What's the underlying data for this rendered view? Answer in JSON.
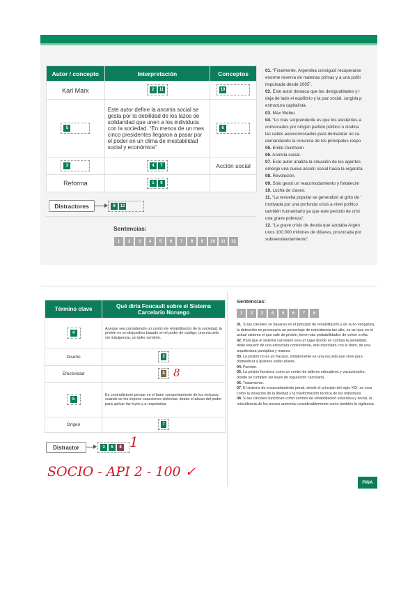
{
  "activity1": {
    "table": {
      "headers": [
        "Autor / concepto",
        "Interpretación",
        "Conceptos"
      ],
      "rows": [
        {
          "autor": "Karl Marx",
          "interp_chips": [
            "2",
            "11"
          ],
          "concept_chips": [
            "10"
          ]
        },
        {
          "autor_chips": [
            "5"
          ],
          "interp_text": "Este autor define la anomia social se gesta por la debilidad de los lazos de solidaridad que unen a los individuos con la sociedad. “En menos de un mes cinco presidentes llegaron a pasar por el poder en un clima de inestabilidad social y económica”",
          "concept_chips": [
            "6"
          ]
        },
        {
          "autor_chips": [
            "3"
          ],
          "interp_chips": [
            "4",
            "7"
          ],
          "concepto": "Acción social"
        },
        {
          "autor": "Reforma",
          "interp_chips": [
            "1",
            "9"
          ]
        }
      ]
    },
    "distractores_label": "Distractores",
    "distractores_chips": [
      "8",
      "12"
    ],
    "sentencias_label": "Sentencias:",
    "sentencias": [
      "1",
      "2",
      "3",
      "4",
      "5",
      "6",
      "7",
      "8",
      "9",
      "10",
      "11",
      "12"
    ],
    "lines": [
      {
        "n": "01.",
        "t": " “Finalmente, Argentina consiguió recuperarse"
      },
      {
        "n": "",
        "t": "enorme reserva de materias primas y a una políti"
      },
      {
        "n": "",
        "t": "impulsada desde 2005”."
      },
      {
        "n": "02.",
        "t": " Este autor destaca que las desigualdades y l"
      },
      {
        "n": "",
        "t": "deja de lado el equilibrio y la paz social, surgida p"
      },
      {
        "n": "",
        "t": "estructura capitalista."
      },
      {
        "n": "03.",
        "t": " Max Weber."
      },
      {
        "n": "04.",
        "t": " “Lo más sorprendente es que los asistentes a"
      },
      {
        "n": "",
        "t": "convocados por ningún partido político o sindica"
      },
      {
        "n": "",
        "t": "las calles autoconvocados para demandar un ca"
      },
      {
        "n": "",
        "t": "demandando la renuncia de los principales respo"
      },
      {
        "n": "05.",
        "t": " Emile Durkheim."
      },
      {
        "n": "06.",
        "t": " Anomia social."
      },
      {
        "n": "07.",
        "t": " Este autor analiza la situación de los agentes"
      },
      {
        "n": "",
        "t": "emerge una nueva acción social hacia la organiza"
      },
      {
        "n": "08.",
        "t": " Revolución."
      },
      {
        "n": "09.",
        "t": " Solo gestó un reacomodamiento y fortalecim"
      },
      {
        "n": "10.",
        "t": " Lucha de clases."
      },
      {
        "n": "11.",
        "t": " “La revuelta popular se generalizó al grito de '"
      },
      {
        "n": "",
        "t": "motivada por una profunda crisis a nivel político"
      },
      {
        "n": "",
        "t": "también humanitario ya que este periodo de crisi"
      },
      {
        "n": "",
        "t": "una grave pobreza”."
      },
      {
        "n": "12.",
        "t": " “La grave crisis de deuda que azotaba Argen"
      },
      {
        "n": "",
        "t": "unos 100.000 millones de dólares, provocada por"
      },
      {
        "n": "",
        "t": "sobreendeudamiento”."
      }
    ]
  },
  "activity2": {
    "table": {
      "headers": [
        "Término clave",
        "Qué diría Foucault sobre el Sistema Carcelario Noruego"
      ],
      "rows": [
        {
          "term_chips": [
            "4"
          ],
          "text": "Aunque sea considerado un centro de rehabilitación de la sociedad, la prisión es un dispositivo basado en el poder de castigo, una escuela sin indulgencia, un taller sombrío."
        },
        {
          "term": "Diseño",
          "chips": [
            "3"
          ]
        },
        {
          "term": "Efectividad",
          "chips": [
            "8"
          ],
          "note": "8"
        },
        {
          "term_chips": [
            "5"
          ],
          "text": "Es contradictorio pensar en el buen comportamiento de los reclusos, cuando se les impone coacciones violentas, desde el abuso del poder para aplicar las leyes y a respetarlas."
        },
        {
          "term": "Origen",
          "chips": [
            "7"
          ]
        }
      ]
    },
    "distractor_label": "Distractor",
    "distractor_chips": [
      "3",
      "6",
      "8"
    ],
    "distractor_note": "1",
    "sentencias_label": "Sentencias:",
    "sentencias": [
      "1",
      "2",
      "3",
      "4",
      "5",
      "6",
      "7",
      "8"
    ],
    "paragraphs": [
      {
        "n": "01.",
        "t": " Si las cárceles se basaran en el principio de rehabilitación y de la no venganza, la detención no provocaría un porcentaje de reincidencia tan alto, es así que en el actual sistema el que sale de prisión, tiene más probabilidades de volver a ella."
      },
      {
        "n": "02.",
        "t": " Para que el sistema carcelario sea un lugar donde se cumpla la penalidad, debe requerir de una estructura contundente, arte mezclado con el dolor, de una arquitectura panóptica y masiva."
      },
      {
        "n": "03.",
        "t": " La prisión no es un fracaso, simplemente es una escuela que sirve para domesticar a quienes están afuera."
      },
      {
        "n": "04.",
        "t": " Función."
      },
      {
        "n": "05.",
        "t": " La prisión funciona como un centro de talleres educativos y vacacionales, donde se cumplen las leyes de regulación carcelaria."
      },
      {
        "n": "06.",
        "t": " Tratamiento."
      },
      {
        "n": "07.",
        "t": " El sistema de encarcelamiento penal, desde el principio del siglo XIX, se crea como la privación de la libertad y la trasformación técnica de los individuos."
      },
      {
        "n": "08.",
        "t": " Si las cárceles funcionan como centros de rehabilitación educativa y social, la reincidencia de los presos aumenta considerablemente como también la vigilancia."
      }
    ],
    "finish_label": "FINA"
  },
  "handwriting": "SOCIO - API 2 - 100 ✓",
  "colors": {
    "green": "#0b7d5a",
    "topbar": "#0a8a5f",
    "ink": "#d0182a",
    "grey_chip": "#a9a9a9"
  }
}
